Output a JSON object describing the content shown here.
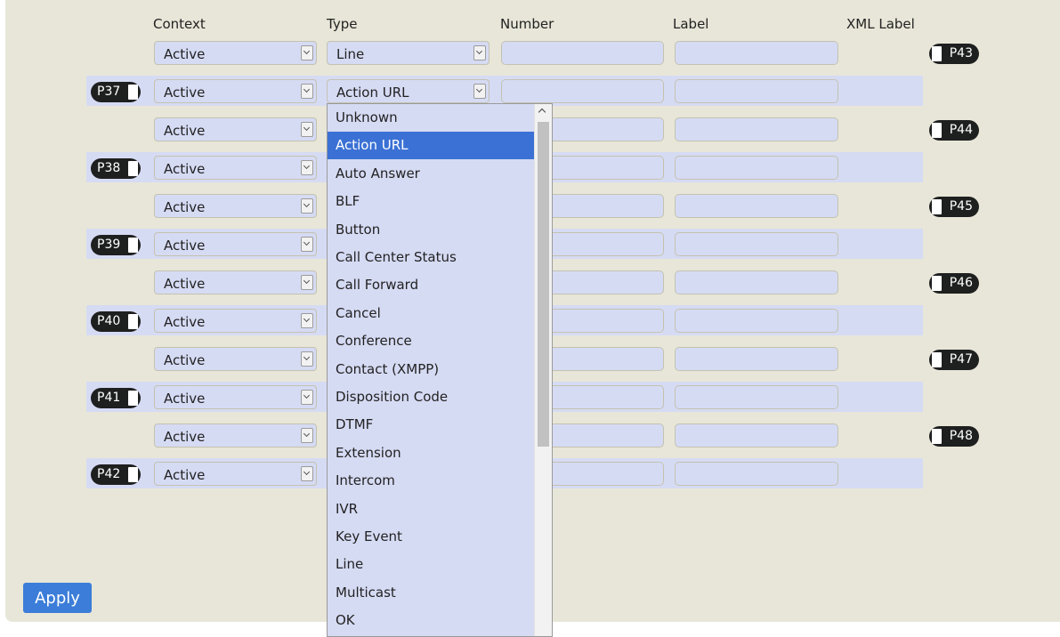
{
  "headers": {
    "context": "Context",
    "type": "Type",
    "number": "Number",
    "label": "Label",
    "xml_label": "XML Label"
  },
  "rows": [
    {
      "context": "Active",
      "type": "Line",
      "tag": "P43",
      "tag_side": "right"
    },
    {
      "context": "Active",
      "type": "Action URL",
      "tag": "P37",
      "tag_side": "left"
    },
    {
      "context": "Active",
      "type": "",
      "tag": "P44",
      "tag_side": "right"
    },
    {
      "context": "Active",
      "type": "",
      "tag": "P38",
      "tag_side": "left"
    },
    {
      "context": "Active",
      "type": "",
      "tag": "P45",
      "tag_side": "right"
    },
    {
      "context": "Active",
      "type": "",
      "tag": "P39",
      "tag_side": "left"
    },
    {
      "context": "Active",
      "type": "",
      "tag": "P46",
      "tag_side": "right"
    },
    {
      "context": "Active",
      "type": "",
      "tag": "P40",
      "tag_side": "left"
    },
    {
      "context": "Active",
      "type": "",
      "tag": "P47",
      "tag_side": "right"
    },
    {
      "context": "Active",
      "type": "",
      "tag": "P41",
      "tag_side": "left"
    },
    {
      "context": "Active",
      "type": "",
      "tag": "P48",
      "tag_side": "right"
    },
    {
      "context": "Active",
      "type": "",
      "tag": "P42",
      "tag_side": "left"
    }
  ],
  "dropdown": {
    "selected": "Action URL",
    "options": [
      "Unknown",
      "Action URL",
      "Auto Answer",
      "BLF",
      "Button",
      "Call Center Status",
      "Call Forward",
      "Cancel",
      "Conference",
      "Contact (XMPP)",
      "Disposition Code",
      "DTMF",
      "Extension",
      "Intercom",
      "IVR",
      "Key Event",
      "Line",
      "Multicast",
      "OK"
    ]
  },
  "apply_label": "Apply",
  "colors": {
    "panel_bg": "#e8e6d8",
    "field_bg": "#d6dbf4",
    "accent": "#3b7dd8",
    "tag_bg": "#1e1f1f"
  }
}
